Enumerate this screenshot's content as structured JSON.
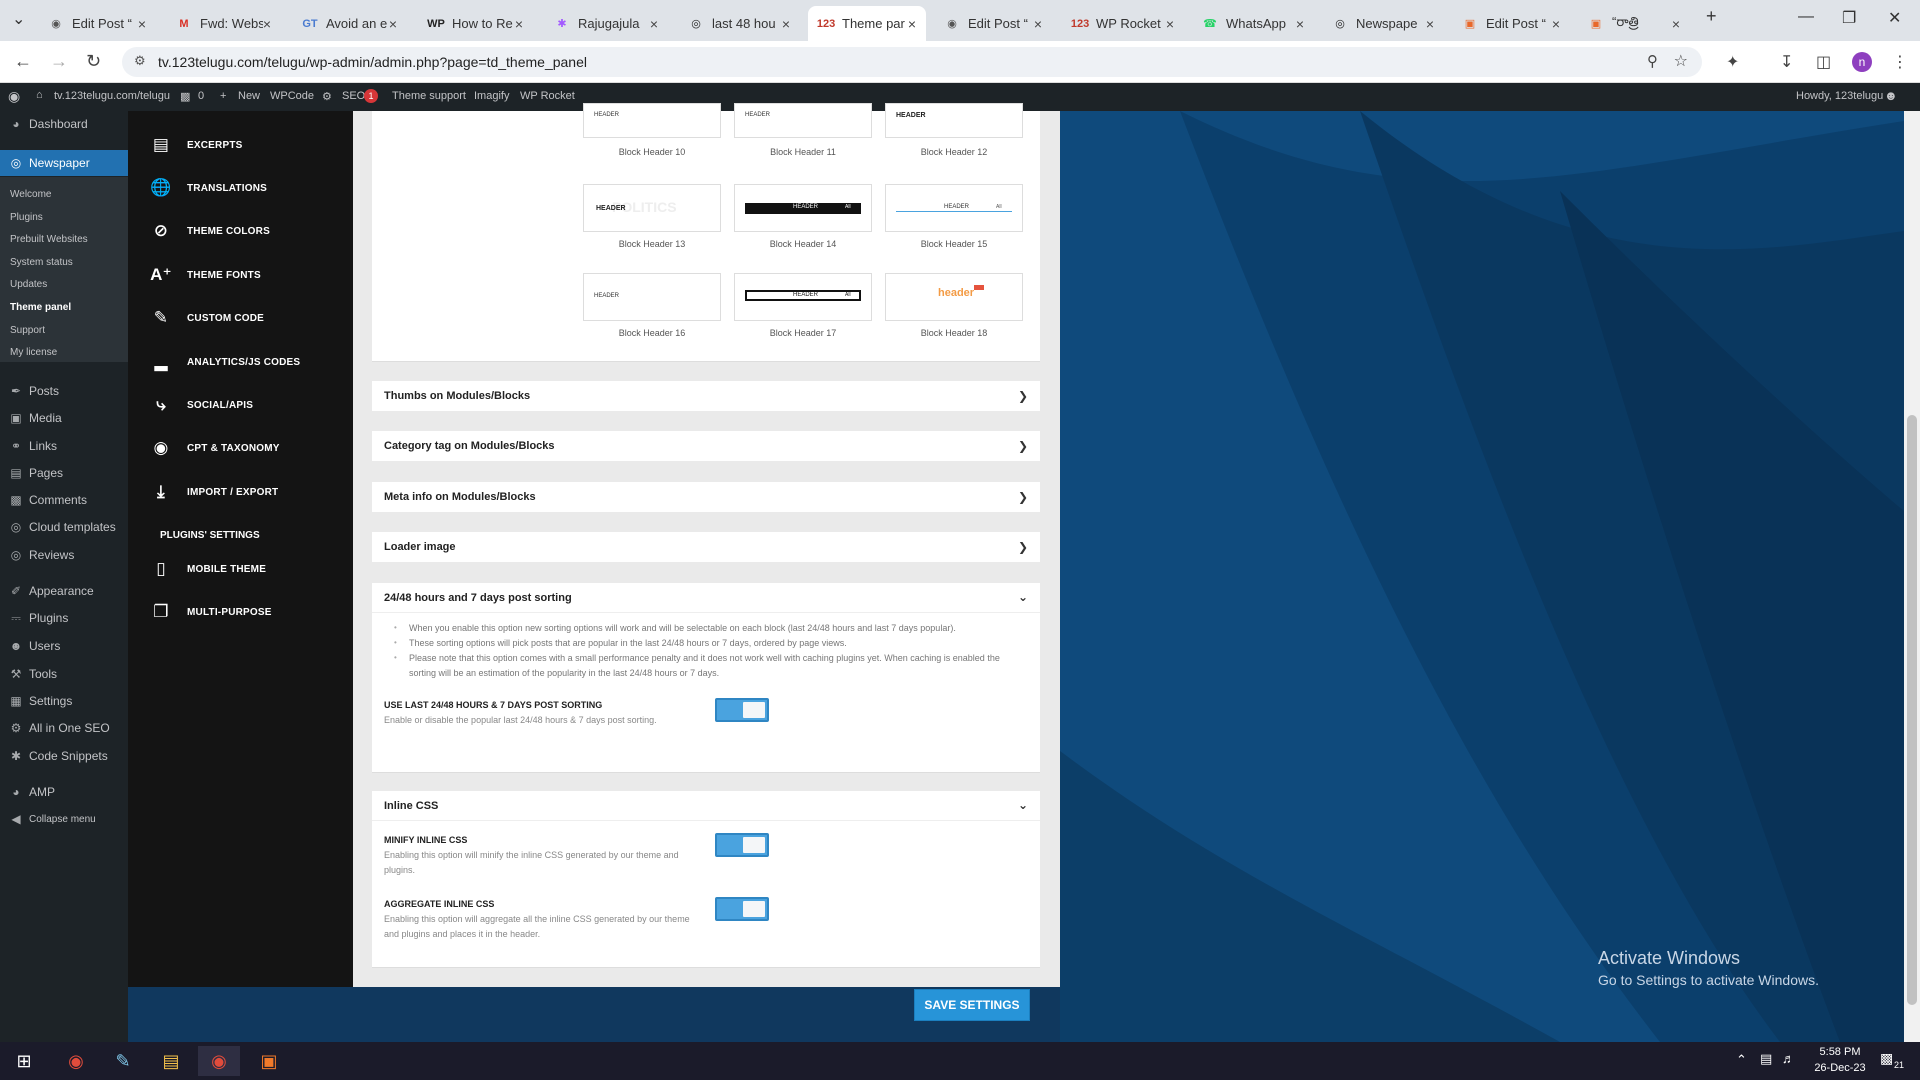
{
  "browser": {
    "tabs": [
      {
        "title": "Edit Post “",
        "icon": "wordpress-icon"
      },
      {
        "title": "Fwd: Webs",
        "icon": "gmail-icon"
      },
      {
        "title": "Avoid an e",
        "icon": "gt-icon"
      },
      {
        "title": "How to Re",
        "icon": "wp-icon"
      },
      {
        "title": "Rajugajula",
        "icon": "figma-icon"
      },
      {
        "title": "last 48 hou",
        "icon": "eye-icon"
      },
      {
        "title": "Theme par",
        "icon": "123-icon",
        "active": true
      },
      {
        "title": "Edit Post “",
        "icon": "wordpress-icon"
      },
      {
        "title": "WP Rocket",
        "icon": "123-icon"
      },
      {
        "title": "WhatsApp",
        "icon": "whatsapp-icon"
      },
      {
        "title": "Newspape",
        "icon": "eye-icon"
      },
      {
        "title": "Edit Post “",
        "icon": "box-icon"
      },
      {
        "title": "“రాత్రి",
        "icon": "box-icon"
      }
    ],
    "new_tab": "+",
    "url": "tv.123telugu.com/telugu/wp-admin/admin.php?page=td_theme_panel",
    "profile_initial": "n"
  },
  "adminbar": {
    "site": "tv.123telugu.com/telugu",
    "comments": "0",
    "new": "New",
    "wpcode": "WPCode",
    "seo": "SEO",
    "seo_badge": "1",
    "theme_support": "Theme support",
    "imagify": "Imagify",
    "wprocket": "WP Rocket",
    "howdy": "Howdy, 123telugu"
  },
  "wpmenu": {
    "dashboard": "Dashboard",
    "newspaper": "Newspaper",
    "sub": [
      "Welcome",
      "Plugins",
      "Prebuilt Websites",
      "System status",
      "Updates",
      "Theme panel",
      "Support",
      "My license"
    ],
    "items": [
      "Posts",
      "Media",
      "Links",
      "Pages",
      "Comments",
      "Cloud templates",
      "Reviews",
      "Appearance",
      "Plugins",
      "Users",
      "Tools",
      "Settings",
      "All in One SEO",
      "Code Snippets",
      "AMP",
      "Collapse menu"
    ]
  },
  "tdnav": {
    "items": [
      "EXCERPTS",
      "TRANSLATIONS",
      "THEME COLORS",
      "THEME FONTS",
      "CUSTOM CODE",
      "ANALYTICS/JS CODES",
      "SOCIAL/APIS",
      "CPT & TAXONOMY",
      "IMPORT / EXPORT"
    ],
    "plugins_heading": "PLUGINS' SETTINGS",
    "plugin_items": [
      "MOBILE THEME",
      "MULTI-PURPOSE"
    ]
  },
  "headers": {
    "captions": [
      "Block Header 10",
      "Block Header 11",
      "Block Header 12",
      "Block Header 13",
      "Block Header 14",
      "Block Header 15",
      "Block Header 16",
      "Block Header 17",
      "Block Header 18"
    ],
    "thumb_texts": [
      "HEADER",
      "HEADER",
      "HEADER",
      "HEADER",
      "HEADER",
      "HEADER",
      "HEADER",
      "HEADER",
      "header"
    ],
    "watermark": "POLITICS",
    "all_label": "All"
  },
  "sections": {
    "thumbs": "Thumbs on Modules/Blocks",
    "category": "Category tag on Modules/Blocks",
    "meta": "Meta info on Modules/Blocks",
    "loader": "Loader image",
    "sorting": "24/48 hours and 7 days post sorting",
    "inline": "Inline CSS"
  },
  "sorting_panel": {
    "bullets": [
      "When you enable this option new sorting options will work and will be selectable on each block (last 24/48 hours and last 7 days popular).",
      "These sorting options will pick posts that are popular in the last 24/48 hours or 7 days, ordered by page views.",
      "Please note that this option comes with a small performance penalty and it does not work well with caching plugins yet. When caching is enabled the sorting will be an estimation of the popularity in the last 24/48 hours or 7 days."
    ],
    "option_label": "USE LAST 24/48 HOURS & 7 DAYS POST SORTING",
    "option_desc": "Enable or disable the popular last 24/48 hours & 7 days post sorting."
  },
  "inline_panel": {
    "minify_label": "MINIFY INLINE CSS",
    "minify_desc": "Enabling this option will minify the inline CSS generated by our theme and plugins.",
    "aggregate_label": "AGGREGATE INLINE CSS",
    "aggregate_desc": "Enabling this option will aggregate all the inline CSS generated by our theme and plugins and places it in the header."
  },
  "save_label": "SAVE SETTINGS",
  "activate": {
    "title": "Activate Windows",
    "sub": "Go to Settings to activate Windows."
  },
  "taskbar": {
    "time": "5:58 PM",
    "date": "26-Dec-23",
    "notif": "21"
  },
  "colors": {
    "wp_dark": "#1d2327",
    "wp_blue": "#2271b1",
    "td_dark": "#141414",
    "toggle_blue": "#4aa3df",
    "bg_blue": "#114c80",
    "save_blue": "#2794d8"
  }
}
